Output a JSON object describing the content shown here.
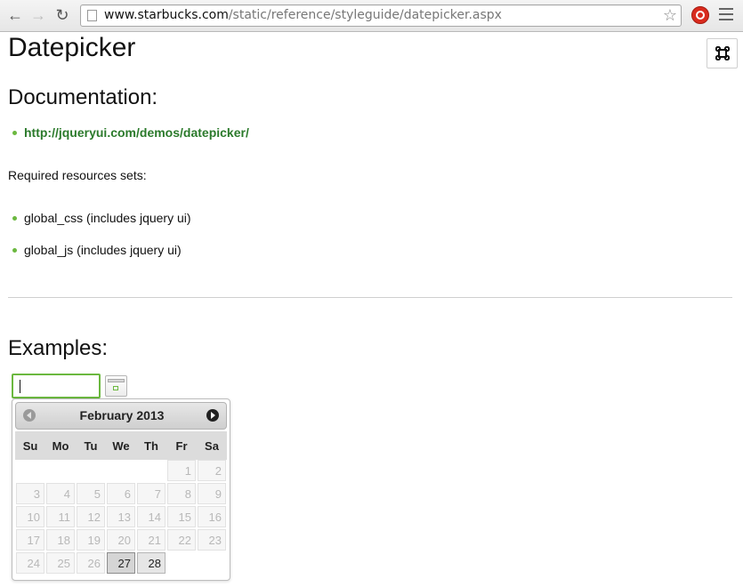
{
  "browser": {
    "url_host": "www.starbucks.com",
    "url_path": "/static/reference/styleguide/datepicker.aspx",
    "nav": {
      "back": "←",
      "forward": "→",
      "reload": "↻"
    },
    "star": "☆"
  },
  "page": {
    "title": "Datepicker",
    "corner_button_icon": "⌘",
    "documentation": {
      "heading": "Documentation:",
      "link": "http://jqueryui.com/demos/datepicker/"
    },
    "resources": {
      "label": "Required resources sets:",
      "items": [
        "global_css (includes jquery ui)",
        "global_js (includes jquery ui)"
      ]
    },
    "examples": {
      "heading": "Examples:",
      "input_value": ""
    }
  },
  "datepicker": {
    "title": "February 2013",
    "weekdays": [
      "Su",
      "Mo",
      "Tu",
      "We",
      "Th",
      "Fr",
      "Sa"
    ],
    "weeks": [
      [
        "",
        "",
        "",
        "",
        "",
        "1",
        "2"
      ],
      [
        "3",
        "4",
        "5",
        "6",
        "7",
        "8",
        "9"
      ],
      [
        "10",
        "11",
        "12",
        "13",
        "14",
        "15",
        "16"
      ],
      [
        "17",
        "18",
        "19",
        "20",
        "21",
        "22",
        "23"
      ],
      [
        "24",
        "25",
        "26",
        "27",
        "28",
        "",
        ""
      ]
    ],
    "today": "27",
    "selectable": [
      "27",
      "28"
    ]
  },
  "colors": {
    "accent_green": "#6bb83f",
    "link_green": "#2b7a2b"
  }
}
